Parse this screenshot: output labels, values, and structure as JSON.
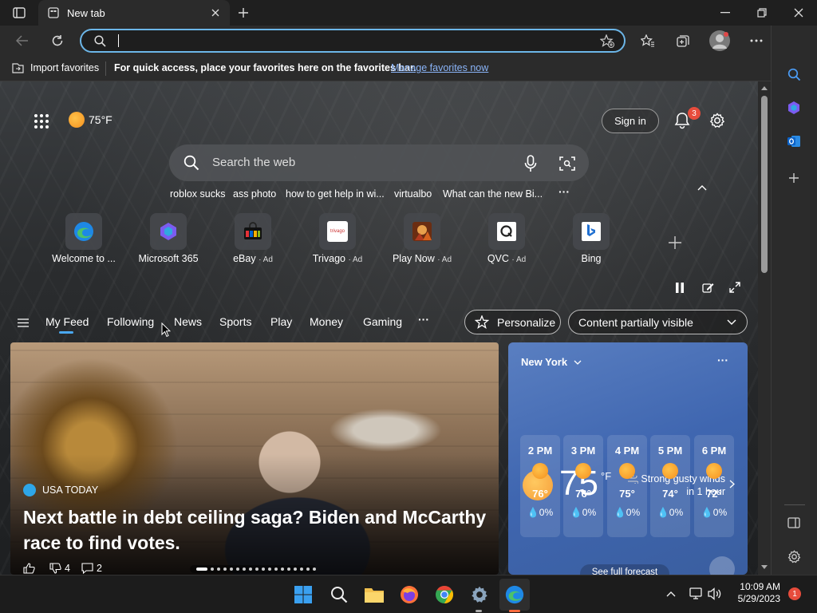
{
  "browser": {
    "tab_title": "New tab",
    "address_value": "",
    "favorites_bar": {
      "import_label": "Import favorites",
      "hint": "For quick access, place your favorites here on the favorites bar.",
      "manage_link": "Manage favorites now"
    }
  },
  "page": {
    "weather_temp": "75°F",
    "sign_in_label": "Sign in",
    "notification_count": "3",
    "search_placeholder": "Search the web",
    "suggestions": [
      "roblox sucks",
      "ass photo",
      "how to get help in wi...",
      "virtualbo",
      "What can the new Bi..."
    ],
    "more_label": "···",
    "quick_links": [
      {
        "label": "Welcome to ...",
        "ad": ""
      },
      {
        "label": "Microsoft 365",
        "ad": ""
      },
      {
        "label": "eBay",
        "ad": "· Ad"
      },
      {
        "label": "Trivago",
        "ad": "· Ad"
      },
      {
        "label": "Play Now",
        "ad": "· Ad"
      },
      {
        "label": "QVC",
        "ad": "· Ad"
      },
      {
        "label": "Bing",
        "ad": ""
      }
    ],
    "trivago_text": "trivago",
    "feed_tabs": [
      "My Feed",
      "Following",
      "News",
      "Sports",
      "Play",
      "Money",
      "Gaming"
    ],
    "feed_more": "···",
    "personalize_label": "Personalize",
    "content_visibility": "Content partially visible"
  },
  "news": {
    "source": "USA TODAY",
    "headline": "Next battle in debt ceiling saga? Biden and McCarthy race to find votes.",
    "dislikes": "4",
    "comments": "2"
  },
  "weather_card": {
    "city": "New York",
    "temp": "75",
    "unit": "°F",
    "alert": "Strong gusty winds in 1 hour",
    "more": "···",
    "hours": [
      {
        "time": "2 PM",
        "temp": "76°",
        "precip": "0%"
      },
      {
        "time": "3 PM",
        "temp": "76°",
        "precip": "0%"
      },
      {
        "time": "4 PM",
        "temp": "75°",
        "precip": "0%"
      },
      {
        "time": "5 PM",
        "temp": "74°",
        "precip": "0%"
      },
      {
        "time": "6 PM",
        "temp": "72°",
        "precip": "0%"
      }
    ],
    "forecast_link": "See full forecast"
  },
  "taskbar": {
    "time": "10:09 AM",
    "date": "5/29/2023",
    "notification_count": "1"
  },
  "colors": {
    "accent": "#6cb6e8",
    "badge": "#e74c3c",
    "sun": "#f5a623"
  }
}
